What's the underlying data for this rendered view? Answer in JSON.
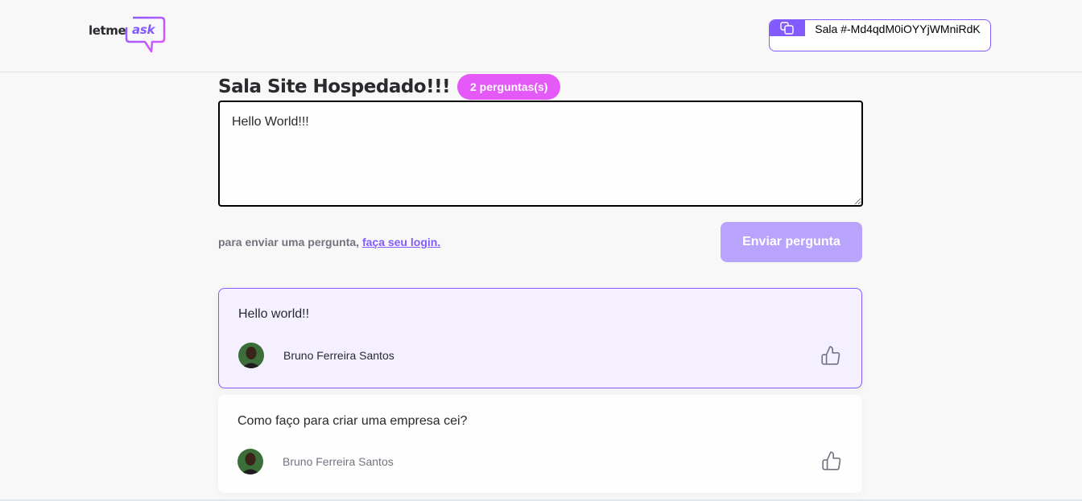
{
  "header": {
    "logo_prefix": "letme",
    "logo_suffix": "ask",
    "room_code": "Sala #-Md4qdM0iOYYjWMniRdK"
  },
  "room": {
    "title": "Sala Site Hospedado!!!",
    "question_count": "2 perguntas(s)"
  },
  "form": {
    "input_value": "Hello World!!!",
    "hint_text": "para enviar uma pergunta, ",
    "login_link": "faça seu login.",
    "send_label": "Enviar pergunta"
  },
  "questions": [
    {
      "text": "Hello world!!",
      "author": "Bruno Ferreira Santos",
      "highlighted": true,
      "like_icon": "thumbs-up-icon"
    },
    {
      "text": "Como faço para criar uma empresa cei?",
      "author": "Bruno Ferreira Santos",
      "highlighted": false,
      "like_icon": "thumbs-up-icon"
    }
  ],
  "colors": {
    "primary": "#835afd",
    "badge": "#e559f9",
    "send_disabled": "#b8a3fd",
    "highlight_bg": "#f4f0ff",
    "background": "#f8f8f8"
  }
}
